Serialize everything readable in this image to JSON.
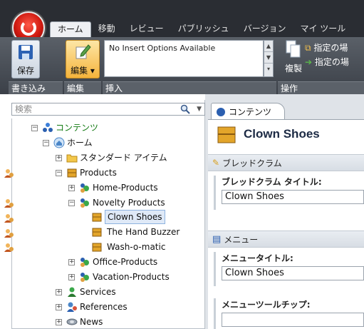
{
  "ribbon": {
    "tabs": [
      "ホーム",
      "移動",
      "レビュー",
      "パブリッシュ",
      "バージョン",
      "マイ ツール"
    ],
    "active_tab": "ホーム",
    "save_label": "保存",
    "edit_label": "編集",
    "insert_message": "No Insert Options Available",
    "copy_label": "複製",
    "op1_label": "指定の場",
    "op2_label": "指定の場",
    "groups": {
      "write": "書き込み",
      "edit": "編集",
      "insert": "挿入",
      "operation": "操作"
    }
  },
  "tree": {
    "search_placeholder": "検索",
    "nodes": [
      {
        "label": "コンテンツ",
        "icon": "content-tree-icon",
        "expander": "minus"
      },
      {
        "label": "ホーム",
        "icon": "home-icon",
        "expander": "minus"
      },
      {
        "label": "スタンダード アイテム",
        "icon": "folder-icon",
        "expander": "plus"
      },
      {
        "label": "Products",
        "icon": "products-icon",
        "expander": "minus"
      },
      {
        "label": "Home-Products",
        "icon": "item-group-icon",
        "expander": "plus"
      },
      {
        "label": "Novelty Products",
        "icon": "item-group-icon",
        "expander": "minus"
      },
      {
        "label": "Clown Shoes",
        "icon": "product-icon",
        "expander": "",
        "selected": true
      },
      {
        "label": "The Hand Buzzer",
        "icon": "product-icon",
        "expander": ""
      },
      {
        "label": "Wash-o-matic",
        "icon": "product-icon",
        "expander": ""
      },
      {
        "label": "Office-Products",
        "icon": "item-group-icon",
        "expander": "plus"
      },
      {
        "label": "Vacation-Products",
        "icon": "item-group-icon",
        "expander": "plus"
      },
      {
        "label": "Services",
        "icon": "services-icon",
        "expander": "plus"
      },
      {
        "label": "References",
        "icon": "references-icon",
        "expander": "plus"
      },
      {
        "label": "News",
        "icon": "news-icon",
        "expander": "plus"
      }
    ]
  },
  "editor": {
    "tab_label": "コンテンツ",
    "item_title": "Clown Shoes",
    "breadcrumb_section": "ブレッドクラム",
    "breadcrumb_title_label": "ブレッドクラム タイトル:",
    "breadcrumb_title_value": "Clown Shoes",
    "menu_section": "メニュー",
    "menu_title_label": "メニュータイトル:",
    "menu_title_value": "Clown Shoes",
    "menu_tooltip_label": "メニューツールチップ:",
    "menu_tooltip_value": ""
  },
  "colors": {
    "ribbon_bg": "#2a2d33",
    "selection_bg": "#dfe9f7",
    "title_text": "#1c2a44"
  }
}
